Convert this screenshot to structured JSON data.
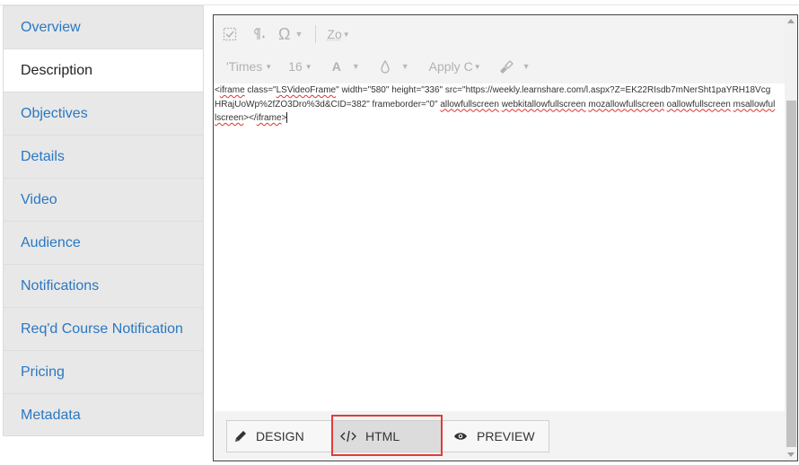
{
  "sidebar": {
    "items": [
      {
        "label": "Overview"
      },
      {
        "label": "Description"
      },
      {
        "label": "Objectives"
      },
      {
        "label": "Details"
      },
      {
        "label": "Video"
      },
      {
        "label": "Audience"
      },
      {
        "label": "Notifications"
      },
      {
        "label": "Req'd Course Notification"
      },
      {
        "label": "Pricing"
      },
      {
        "label": "Metadata"
      }
    ],
    "active": "Description"
  },
  "toolbar": {
    "row1": {
      "zoom_label": "Zo"
    },
    "row2": {
      "font_family": "'Times",
      "font_size": "16",
      "font_color_label": "A",
      "apply_css_label": "Apply C"
    }
  },
  "editor": {
    "code": {
      "p1": "<",
      "w_iframe": "iframe",
      "p2": " class=\"",
      "w_lsvideo": "LSVideoFrame",
      "p3": "\" width=\"580\" height=\"336\" src=\"https://weekly.learnshare.com/l.aspx?Z=EK22RIsdb7mNerSht1paYRH18VcgHRajUoWp%2fZO3Dro%3d&CID=382\" frameborder=\"0\" ",
      "w_allow": "allowfullscreen",
      "p4": " ",
      "w_webkit": "webkitallowfullscreen",
      "p5": " ",
      "w_moz": "mozallowfullscreen",
      "p6": " ",
      "w_o": "oallowfullscreen",
      "p7": " ",
      "w_ms": "msallowfullscreen",
      "p8": "></",
      "w_iframe2": "iframe",
      "p9": ">"
    }
  },
  "modes": {
    "design": "DESIGN",
    "html": "HTML",
    "preview": "PREVIEW",
    "active": "HTML"
  },
  "colors": {
    "link": "#2a78c2",
    "highlight": "#e03c3c"
  },
  "icons": {
    "toolbar": [
      "select-all-icon",
      "paragraph-icon",
      "omega-icon",
      "font-color-icon",
      "background-color-icon",
      "format-stripper-icon"
    ],
    "modes": [
      "pencil-icon",
      "code-icon",
      "eye-icon"
    ]
  }
}
